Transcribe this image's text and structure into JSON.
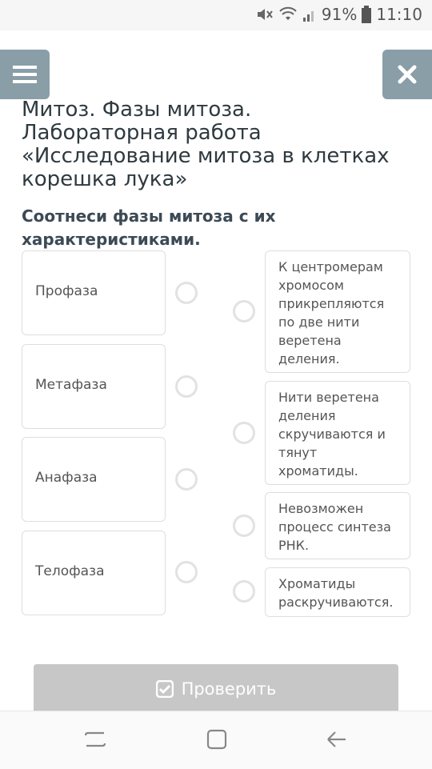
{
  "status_bar": {
    "battery": "91%",
    "time": "11:10"
  },
  "toolbar": {
    "menu_icon": "hamburger-icon",
    "close_icon": "close-icon"
  },
  "lesson": {
    "title": "Митоз. Фазы митоза. Лабораторная работа «Исследование митоза в клетках корешка лука»"
  },
  "task": {
    "question": "Соотнеси фазы митоза с их характеристиками.",
    "left_items": [
      {
        "label": "Профаза"
      },
      {
        "label": "Метафаза"
      },
      {
        "label": "Анафаза"
      },
      {
        "label": "Телофаза"
      }
    ],
    "right_items": [
      {
        "text": "К центромерам хромосом прикрепляются по две нити веретена деления."
      },
      {
        "text": "Нити веретена деления скручиваются и тянут хроматиды."
      },
      {
        "text": "Невозможен процесс синтеза РНК."
      },
      {
        "text": "Хроматиды раскручиваются."
      }
    ],
    "check_button": {
      "label": "Проверить",
      "icon": "checkbox-icon"
    }
  },
  "nav": {
    "recent_icon": "recent-apps-icon",
    "home_icon": "home-icon",
    "back_icon": "back-icon"
  }
}
